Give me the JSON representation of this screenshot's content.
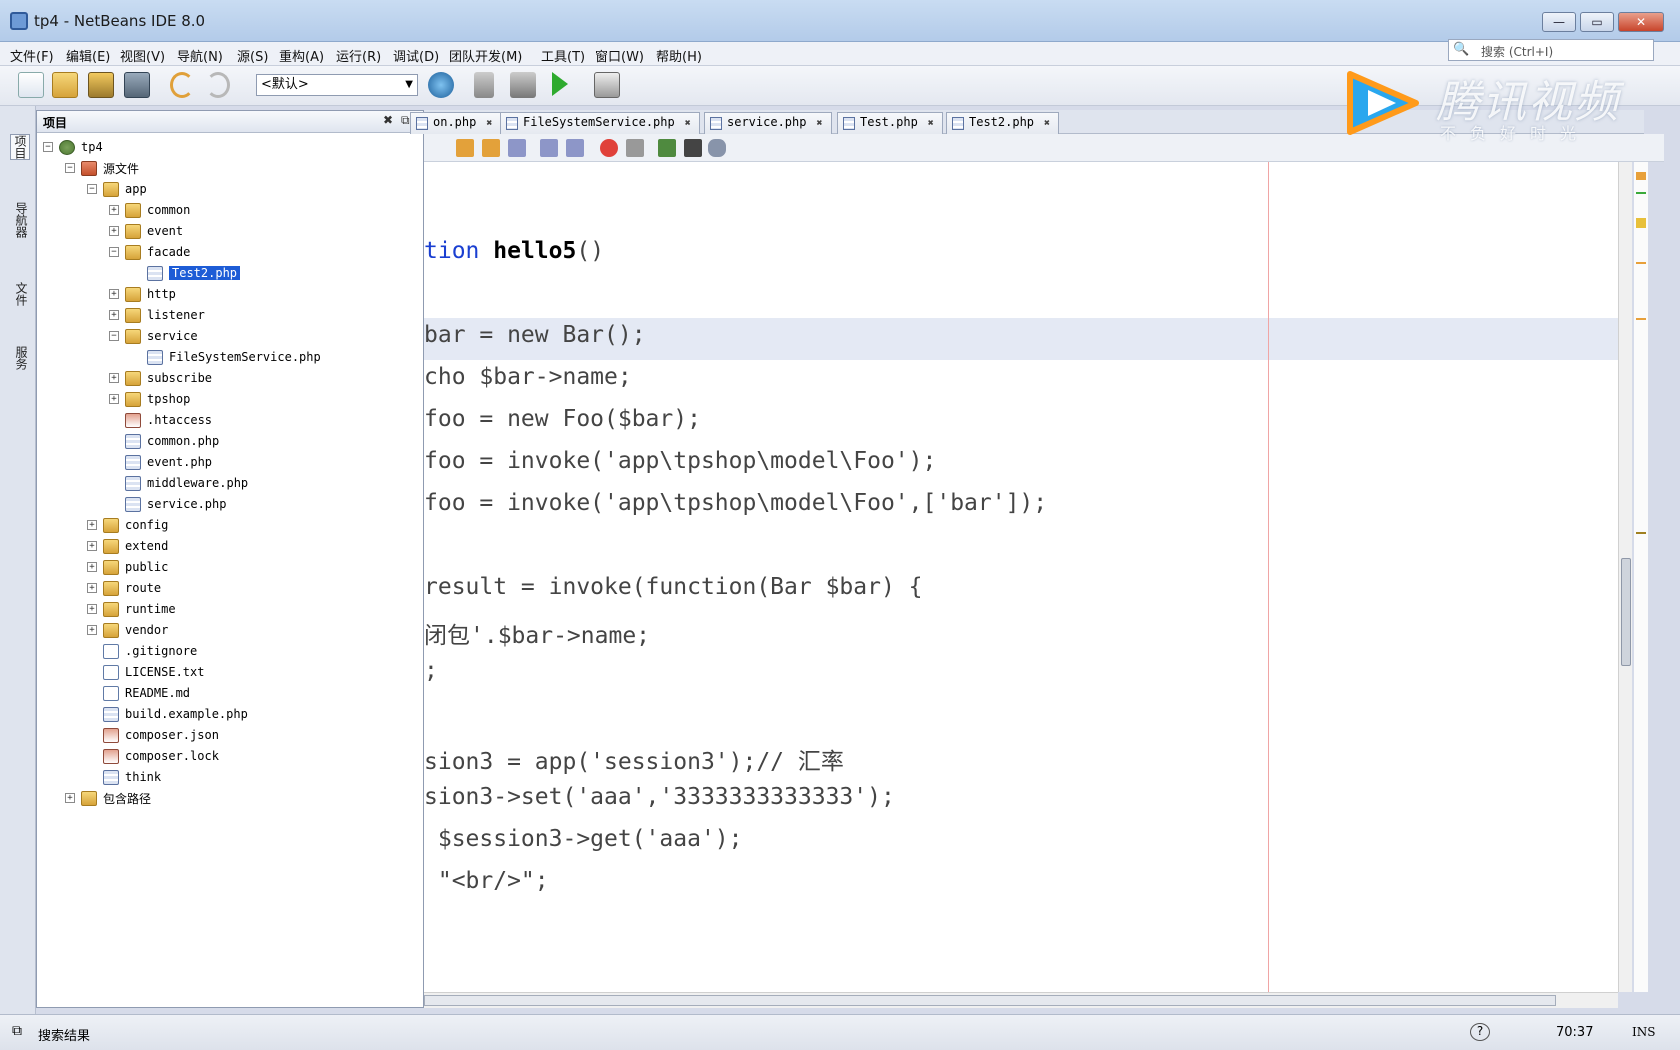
{
  "window": {
    "title": "tp4 - NetBeans IDE 8.0",
    "min": "—",
    "max": "▭",
    "close": "✕"
  },
  "menu": [
    "文件(F)",
    "编辑(E)",
    "视图(V)",
    "导航(N)",
    "源(S)",
    "重构(A)",
    "运行(R)",
    "调试(D)",
    "团队开发(M)",
    "工具(T)",
    "窗口(W)",
    "帮助(H)"
  ],
  "search": {
    "icon": "🔍",
    "placeholder": "搜索 (Ctrl+I)"
  },
  "toolbar": {
    "config": "<默认>"
  },
  "left_tabs": [
    "项目",
    "导航器",
    "文件",
    "服务"
  ],
  "project_panel": {
    "title": "项目"
  },
  "tree": [
    {
      "label": "tp4",
      "indent": 0,
      "exp": "−",
      "icon": "proj"
    },
    {
      "label": "源文件",
      "indent": 1,
      "exp": "−",
      "icon": "src"
    },
    {
      "label": "app",
      "indent": 2,
      "exp": "−",
      "icon": "folder"
    },
    {
      "label": "common",
      "indent": 3,
      "exp": "+",
      "icon": "folder"
    },
    {
      "label": "event",
      "indent": 3,
      "exp": "+",
      "icon": "folder"
    },
    {
      "label": "facade",
      "indent": 3,
      "exp": "−",
      "icon": "folder"
    },
    {
      "label": "Test2.php",
      "indent": 4,
      "exp": "",
      "icon": "php",
      "selected": true
    },
    {
      "label": "http",
      "indent": 3,
      "exp": "+",
      "icon": "folder"
    },
    {
      "label": "listener",
      "indent": 3,
      "exp": "+",
      "icon": "folder"
    },
    {
      "label": "service",
      "indent": 3,
      "exp": "−",
      "icon": "folder"
    },
    {
      "label": "FileSystemService.php",
      "indent": 4,
      "exp": "",
      "icon": "php"
    },
    {
      "label": "subscribe",
      "indent": 3,
      "exp": "+",
      "icon": "folder"
    },
    {
      "label": "tpshop",
      "indent": 3,
      "exp": "+",
      "icon": "folder"
    },
    {
      "label": ".htaccess",
      "indent": 3,
      "exp": "",
      "icon": "special"
    },
    {
      "label": "common.php",
      "indent": 3,
      "exp": "",
      "icon": "php"
    },
    {
      "label": "event.php",
      "indent": 3,
      "exp": "",
      "icon": "php"
    },
    {
      "label": "middleware.php",
      "indent": 3,
      "exp": "",
      "icon": "php"
    },
    {
      "label": "service.php",
      "indent": 3,
      "exp": "",
      "icon": "php"
    },
    {
      "label": "config",
      "indent": 2,
      "exp": "+",
      "icon": "folder"
    },
    {
      "label": "extend",
      "indent": 2,
      "exp": "+",
      "icon": "folder"
    },
    {
      "label": "public",
      "indent": 2,
      "exp": "+",
      "icon": "folder"
    },
    {
      "label": "route",
      "indent": 2,
      "exp": "+",
      "icon": "folder"
    },
    {
      "label": "runtime",
      "indent": 2,
      "exp": "+",
      "icon": "folder"
    },
    {
      "label": "vendor",
      "indent": 2,
      "exp": "+",
      "icon": "folder"
    },
    {
      "label": ".gitignore",
      "indent": 2,
      "exp": "",
      "icon": "file"
    },
    {
      "label": "LICENSE.txt",
      "indent": 2,
      "exp": "",
      "icon": "file"
    },
    {
      "label": "README.md",
      "indent": 2,
      "exp": "",
      "icon": "file"
    },
    {
      "label": "build.example.php",
      "indent": 2,
      "exp": "",
      "icon": "php"
    },
    {
      "label": "composer.json",
      "indent": 2,
      "exp": "",
      "icon": "special"
    },
    {
      "label": "composer.lock",
      "indent": 2,
      "exp": "",
      "icon": "special"
    },
    {
      "label": "think",
      "indent": 2,
      "exp": "",
      "icon": "php"
    },
    {
      "label": "包含路径",
      "indent": 1,
      "exp": "+",
      "icon": "folder"
    }
  ],
  "editor_tabs": [
    "on.php",
    "FileSystemService.php",
    "service.php",
    "Test.php",
    "Test2.php"
  ],
  "code": [
    {
      "row": 2,
      "segs": [
        {
          "t": "tion ",
          "c": "kw"
        },
        {
          "t": "hello5",
          "c": "bold"
        },
        {
          "t": "()",
          "c": ""
        }
      ]
    },
    {
      "row": 4,
      "segs": [
        {
          "t": "bar = new Bar();",
          "c": ""
        }
      ]
    },
    {
      "row": 5,
      "segs": [
        {
          "t": "cho $bar->name;",
          "c": ""
        }
      ]
    },
    {
      "row": 6,
      "segs": [
        {
          "t": "foo = new Foo($bar);",
          "c": ""
        }
      ]
    },
    {
      "row": 7,
      "segs": [
        {
          "t": "foo = invoke('app\\tpshop\\model\\Foo');",
          "c": ""
        }
      ]
    },
    {
      "row": 8,
      "segs": [
        {
          "t": "foo = invoke('app\\tpshop\\model\\Foo',['bar']);",
          "c": ""
        }
      ]
    },
    {
      "row": 10,
      "segs": [
        {
          "t": "result = invoke(function(Bar $bar) {",
          "c": ""
        }
      ]
    },
    {
      "row": 11,
      "segs": [
        {
          "t": "闭包'.$bar->name;",
          "c": ""
        }
      ]
    },
    {
      "row": 12,
      "segs": [
        {
          "t": ";",
          "c": ""
        }
      ]
    },
    {
      "row": 14,
      "segs": [
        {
          "t": "sion3 = app('session3');// 汇率",
          "c": ""
        }
      ]
    },
    {
      "row": 15,
      "segs": [
        {
          "t": "sion3->set('aaa','3333333333333');",
          "c": ""
        }
      ]
    },
    {
      "row": 16,
      "segs": [
        {
          "t": " $session3->get('aaa');",
          "c": ""
        }
      ]
    },
    {
      "row": 17,
      "segs": [
        {
          "t": " \"<br/>\";",
          "c": ""
        }
      ]
    }
  ],
  "status": {
    "search_results": "搜索结果",
    "position": "70:37",
    "mode": "INS"
  },
  "watermark": {
    "brand": "腾讯视频",
    "slogan": "不负好时光"
  }
}
